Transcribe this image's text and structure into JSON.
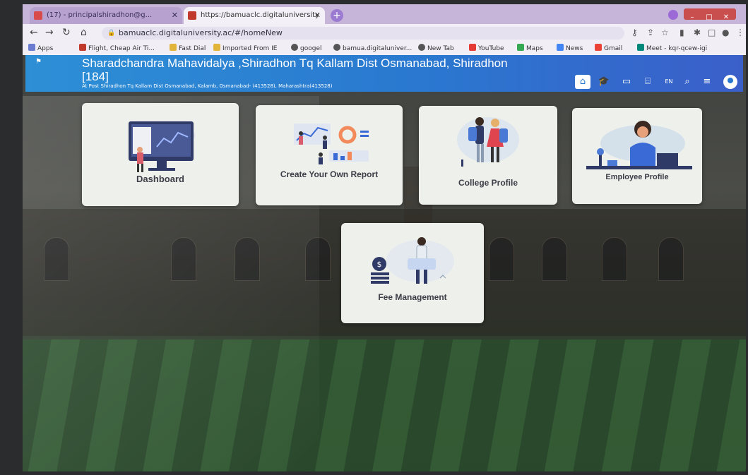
{
  "browser": {
    "tabs": [
      {
        "title": "(17) - principalshiradhon@g...",
        "active": false
      },
      {
        "title": "https://bamuaclc.digitaluniversity",
        "active": true
      }
    ],
    "address": "bamuaclc.digitaluniversity.ac/#/homeNew",
    "bookmarks": [
      "Apps",
      "Flight, Cheap Air Ti...",
      "Fast Dial",
      "Imported From IE",
      "googel",
      "bamua.digitaluniver...",
      "New Tab",
      "YouTube",
      "Maps",
      "News",
      "Gmail",
      "Meet - kqr-qcew-igi"
    ]
  },
  "header": {
    "title": "Sharadchandra Mahavidalya ,Shiradhon Tq Kallam Dist Osmanabad, Shiradhon [184]",
    "address": "At Post Shiradhon Tq Kallam Dist Osmanabad, Kalamb, Osmanabad- (413528), Maharashtra(413528)",
    "language": "EN",
    "icons": [
      "home-icon",
      "graduation-cap-icon",
      "card-icon",
      "institution-icon",
      "language-icon",
      "search-icon",
      "menu-icon",
      "user-avatar-icon"
    ]
  },
  "cards": [
    {
      "label": "Dashboard"
    },
    {
      "label": "Create Your Own Report"
    },
    {
      "label": "College Profile"
    },
    {
      "label": "Employee Profile"
    },
    {
      "label": "Fee Management"
    }
  ],
  "colors": {
    "header_start": "#2d8fd6",
    "header_end": "#3b5fc9",
    "card_bg": "#eef0ec",
    "card_text": "#3c3c46",
    "tab_strip": "#c7b5d9"
  }
}
